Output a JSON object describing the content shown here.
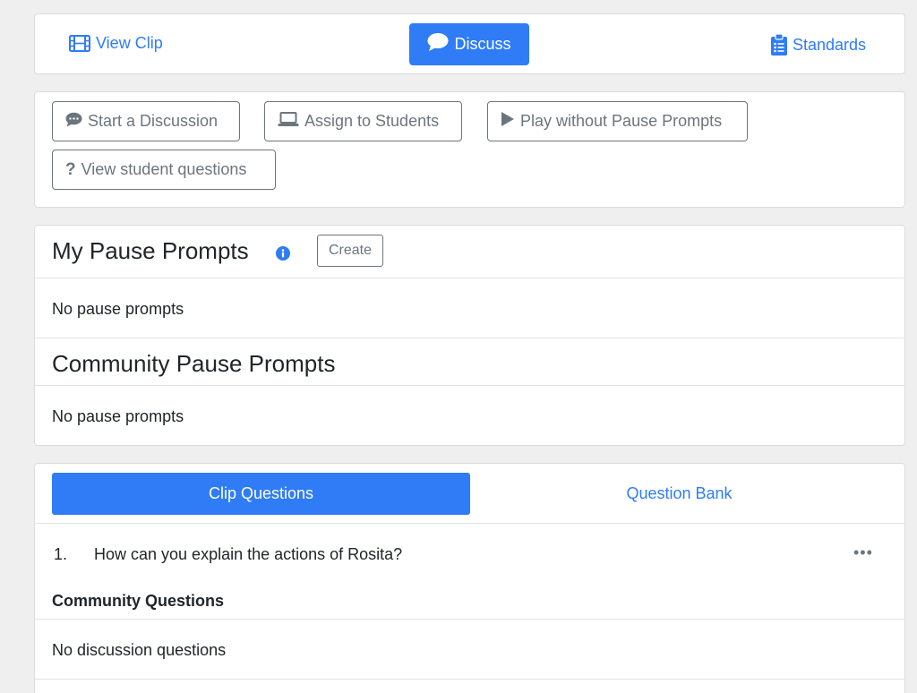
{
  "nav": {
    "view_clip": {
      "label": "View Clip",
      "icon": "film-icon"
    },
    "discuss": {
      "label": "Discuss",
      "icon": "speech-bubble-icon"
    },
    "standards": {
      "label": "Standards",
      "icon": "clipboard-list-icon"
    }
  },
  "actions": {
    "start_discussion": {
      "label": "Start a Discussion",
      "icon": "comment-dots-icon"
    },
    "assign": {
      "label": "Assign to Students",
      "icon": "laptop-icon"
    },
    "play": {
      "label": "Play without Pause Prompts",
      "icon": "play-icon"
    },
    "view_questions": {
      "label": "View student questions",
      "icon": "question-icon"
    }
  },
  "my_prompts": {
    "title": "My Pause Prompts",
    "create_label": "Create",
    "empty_text": "No pause prompts"
  },
  "community_prompts": {
    "title": "Community Pause Prompts",
    "empty_text": "No pause prompts"
  },
  "questions": {
    "tabs": [
      {
        "label": "Clip Questions",
        "active": true
      },
      {
        "label": "Question Bank",
        "active": false
      }
    ],
    "items": [
      {
        "number": "1.",
        "text": "How can you explain the actions of Rosita?"
      }
    ],
    "menu_glyph": "•••",
    "community_title": "Community Questions",
    "community_empty": "No discussion questions"
  },
  "colors": {
    "accent": "#2f7cf6",
    "muted": "#6c757d",
    "background": "#efefef"
  }
}
